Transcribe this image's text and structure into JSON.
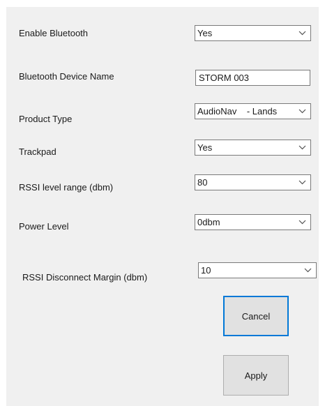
{
  "form": {
    "enable_bluetooth": {
      "label": "Enable Bluetooth",
      "value": "Yes"
    },
    "device_name": {
      "label": "Bluetooth Device Name",
      "value": "STORM 003"
    },
    "product_type": {
      "label": "Product Type",
      "value": "AudioNav    - Lands"
    },
    "trackpad": {
      "label": "Trackpad",
      "value": "Yes"
    },
    "rssi_level_range": {
      "label": "RSSI level range (dbm)",
      "value": "80"
    },
    "power_level": {
      "label": "Power Level",
      "value": "0dbm"
    },
    "rssi_disconnect_margin": {
      "label": "RSSI Disconnect Margin (dbm)",
      "value": "10"
    }
  },
  "buttons": {
    "cancel_label": "Cancel",
    "apply_label": "Apply"
  },
  "icons": {
    "dropdown": "chevron-down-icon"
  },
  "colors": {
    "panel_background": "#f0f0f0",
    "focus_border": "#0078d7",
    "button_face": "#e1e1e1",
    "field_border": "#7a7a7a"
  }
}
